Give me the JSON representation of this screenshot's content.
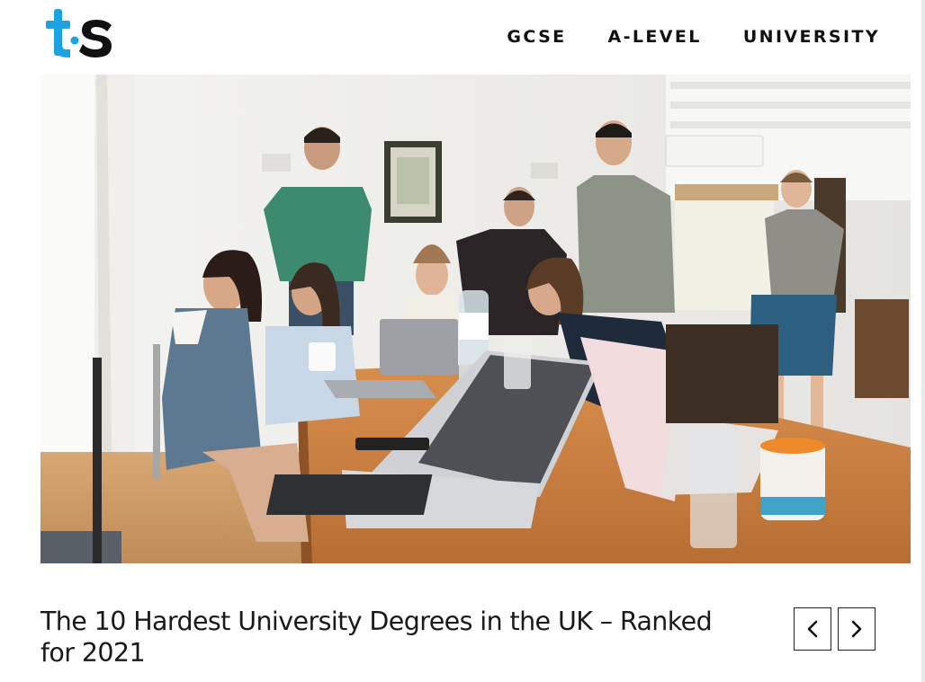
{
  "brand": {
    "logo_letters": "ts",
    "logo_accent_color": "#1ba3e1",
    "logo_dark_color": "#111111"
  },
  "nav": {
    "items": [
      {
        "label": "GCSE"
      },
      {
        "label": "A-LEVEL"
      },
      {
        "label": "UNIVERSITY"
      }
    ]
  },
  "hero": {
    "image_icon": "photo"
  },
  "article": {
    "title": "The 10 Hardest University Degrees in the UK – Ranked for 2021"
  },
  "slider": {
    "prev_icon": "chevron-left-icon",
    "next_icon": "chevron-right-icon"
  }
}
